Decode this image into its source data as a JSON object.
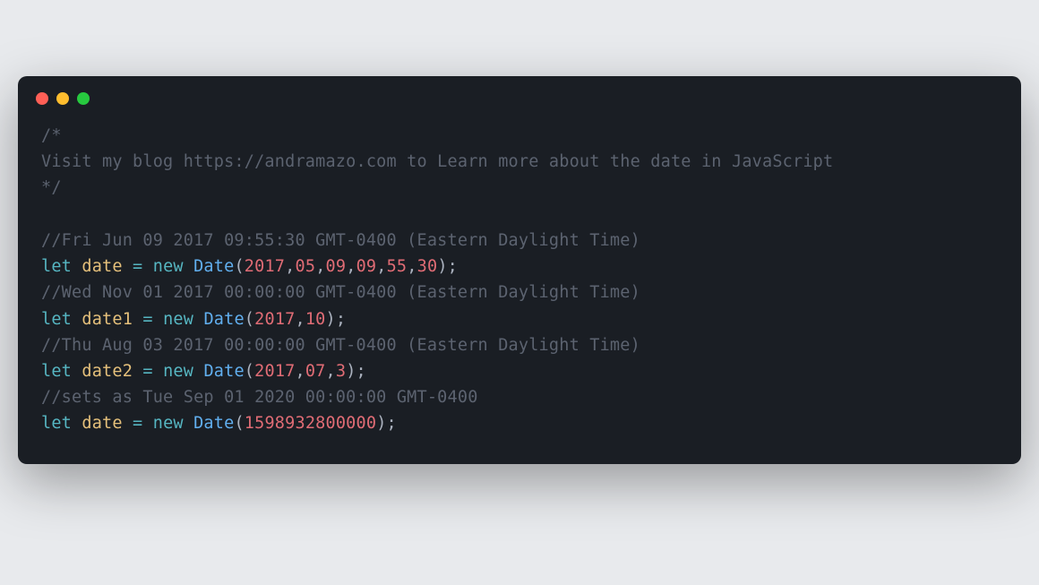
{
  "window": {
    "dots": {
      "red": "#ff5f56",
      "yellow": "#ffbd2e",
      "green": "#27c93f"
    }
  },
  "code": {
    "block_comment_open": "/*",
    "block_comment_body": "Visit my blog https://andramazo.com to Learn more about the date in JavaScript",
    "block_comment_close": "*/",
    "blank": "",
    "l1_comment": "//Fri Jun 09 2017 09:55:30 GMT-0400 (Eastern Daylight Time)",
    "l1_kw": "let",
    "l1_id": "date",
    "l1_eq": " = ",
    "l1_new": "new",
    "l1_cls": "Date",
    "l1_open": "(",
    "l1_a1": "2017",
    "l1_c": ",",
    "l1_a2": "05",
    "l1_a3": "09",
    "l1_a4": "09",
    "l1_a5": "55",
    "l1_a6": "30",
    "l1_close": ");",
    "l2_comment": "//Wed Nov 01 2017 00:00:00 GMT-0400 (Eastern Daylight Time)",
    "l2_kw": "let",
    "l2_id": "date1",
    "l2_eq": " = ",
    "l2_new": "new",
    "l2_cls": "Date",
    "l2_open": "(",
    "l2_a1": "2017",
    "l2_c": ",",
    "l2_a2": "10",
    "l2_close": ");",
    "l3_comment": "//Thu Aug 03 2017 00:00:00 GMT-0400 (Eastern Daylight Time)",
    "l3_kw": "let",
    "l3_id": "date2",
    "l3_eq": " = ",
    "l3_new": "new",
    "l3_cls": "Date",
    "l3_open": "(",
    "l3_a1": "2017",
    "l3_c": ",",
    "l3_a2": "07",
    "l3_a3": "3",
    "l3_close": ");",
    "l4_comment": "//sets as Tue Sep 01 2020 00:00:00 GMT-0400",
    "l4_kw": "let",
    "l4_id": "date",
    "l4_eq": " = ",
    "l4_new": "new",
    "l4_cls": "Date",
    "l4_open": "(",
    "l4_a1": "1598932800000",
    "l4_close": ");"
  }
}
